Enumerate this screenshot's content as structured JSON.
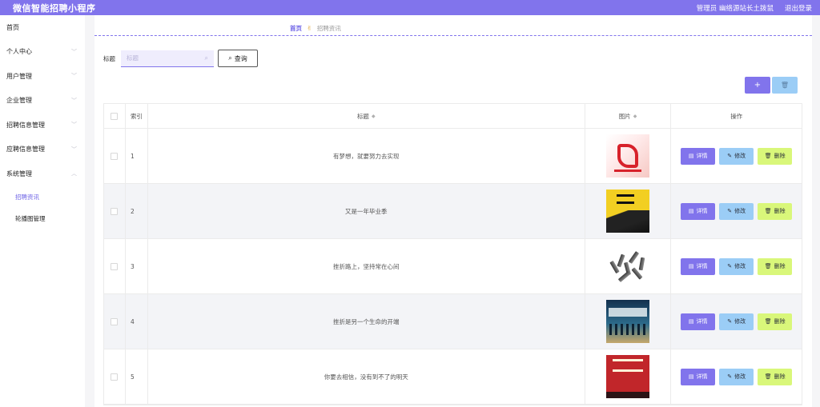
{
  "header": {
    "app_title": "微信智能招聘小程序",
    "user_label": "管理员 幽络源站长土拨鼠",
    "logout": "退出登录"
  },
  "sidebar": {
    "items": [
      {
        "label": "首页",
        "chevron": ""
      },
      {
        "label": "个人中心",
        "chevron": "﹀"
      },
      {
        "label": "用户管理",
        "chevron": "﹀"
      },
      {
        "label": "企业管理",
        "chevron": "﹀"
      },
      {
        "label": "招聘信息管理",
        "chevron": "﹀"
      },
      {
        "label": "应聘信息管理",
        "chevron": "﹀"
      },
      {
        "label": "系统管理",
        "chevron": "︿"
      }
    ],
    "subitems": [
      {
        "label": "招聘资讯",
        "active": true
      },
      {
        "label": "轮播图管理",
        "active": false
      }
    ]
  },
  "breadcrumb": {
    "home": "首页",
    "separator_icon": "hand-icon",
    "current": "招聘资讯"
  },
  "search": {
    "label": "标题",
    "placeholder": "标题",
    "value": "",
    "button": "查询"
  },
  "toolbar": {
    "add_symbol": "+",
    "delete_icon": "trash-icon"
  },
  "table": {
    "headers": {
      "index": "索引",
      "title": "标题",
      "image": "图片",
      "actions": "操作"
    },
    "rows": [
      {
        "index": "1",
        "title": "有梦想，就要努力去实现"
      },
      {
        "index": "2",
        "title": "又是一年毕业季"
      },
      {
        "index": "3",
        "title": "挫折路上，坚持常在心间"
      },
      {
        "index": "4",
        "title": "挫折是另一个生命的开端"
      },
      {
        "index": "5",
        "title": "你要去相信，没有到不了的明天"
      }
    ],
    "actions": {
      "detail": "详情",
      "edit": "修改",
      "delete": "删除"
    }
  },
  "colors": {
    "brand": "#8174ec",
    "edit": "#9bcdf6",
    "delete": "#d9f77a"
  }
}
